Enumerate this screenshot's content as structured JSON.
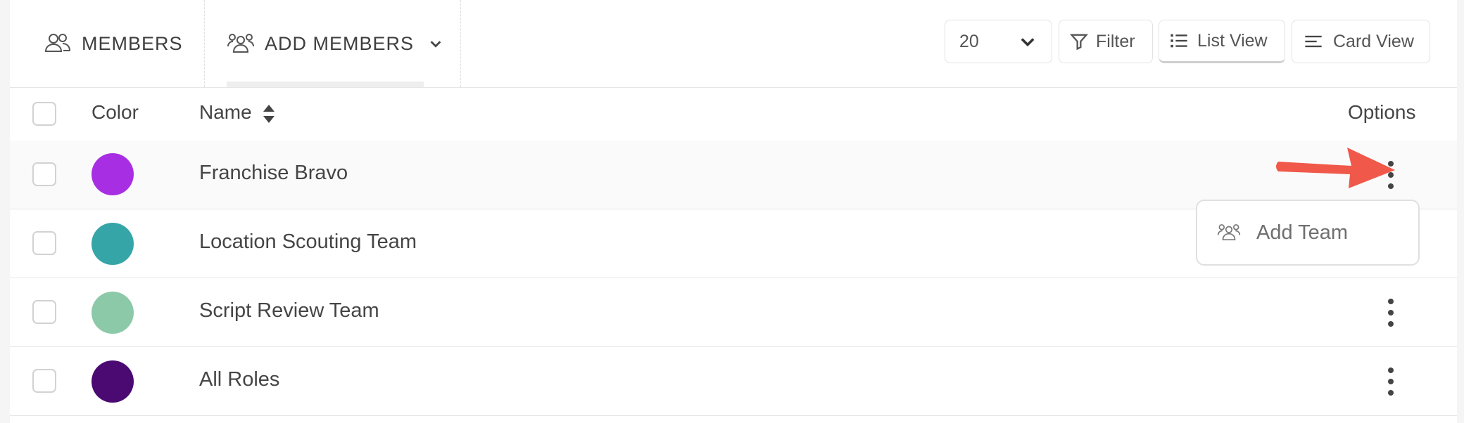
{
  "tabs": {
    "members_label": "MEMBERS",
    "add_members_label": "ADD MEMBERS"
  },
  "toolbar": {
    "per_page_value": "20",
    "filter_label": "Filter",
    "list_view_label": "List View",
    "card_view_label": "Card View"
  },
  "table": {
    "headers": {
      "color": "Color",
      "name": "Name",
      "options": "Options"
    },
    "rows": [
      {
        "name": "Franchise Bravo",
        "color": "#a82ee3"
      },
      {
        "name": "Location Scouting Team",
        "color": "#36a5a8"
      },
      {
        "name": "Script Review Team",
        "color": "#8cc9a8"
      },
      {
        "name": "All Roles",
        "color": "#4a0a72"
      }
    ]
  },
  "dropdown_menu": {
    "add_team_label": "Add Team"
  },
  "colors": {
    "annotation_arrow": "#f0584a",
    "border": "#e6e6e6"
  },
  "icons": [
    "members-icon",
    "add-members-icon",
    "chevron-down-icon",
    "filter-icon",
    "list-icon",
    "card-view-icon",
    "sort-icon",
    "kebab-icon",
    "team-icon",
    "annotation-arrow"
  ]
}
